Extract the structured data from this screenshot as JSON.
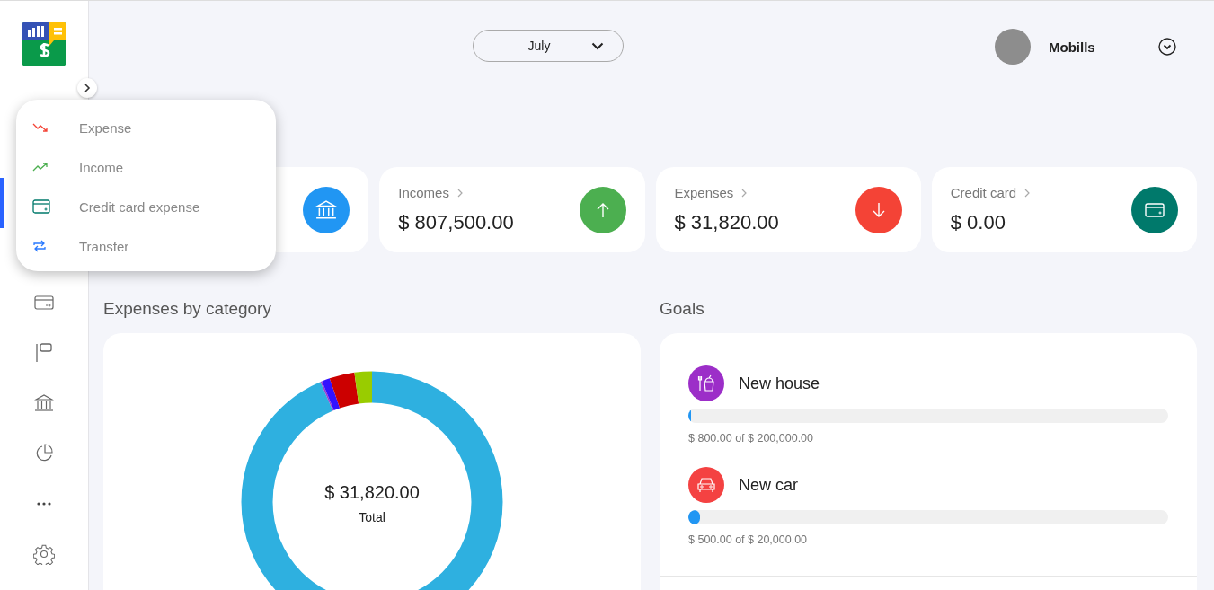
{
  "sidebar": {
    "items": [
      {
        "kind": "card"
      },
      {
        "kind": "flag"
      },
      {
        "kind": "bank"
      },
      {
        "kind": "pie"
      },
      {
        "kind": "more"
      },
      {
        "kind": "settings"
      }
    ]
  },
  "new_menu": {
    "items": [
      {
        "kind": "expense",
        "label": "Expense"
      },
      {
        "kind": "income",
        "label": "Income"
      },
      {
        "kind": "credit_card",
        "label": "Credit card expense"
      },
      {
        "kind": "transfer",
        "label": "Transfer"
      }
    ]
  },
  "month_selector": {
    "value": "July"
  },
  "user": {
    "name": "Mobills"
  },
  "summary_cards": [
    {
      "kind": "balance"
    },
    {
      "kind": "income",
      "label": "Incomes",
      "amount": "$ 807,500.00"
    },
    {
      "kind": "expense",
      "label": "Expenses",
      "amount": "$ 31,820.00"
    },
    {
      "kind": "credit_card",
      "label": "Credit card",
      "amount": "$ 0.00"
    }
  ],
  "expenses_by_category": {
    "title": "Expenses by category",
    "total": "$ 31,820.00",
    "total_label": "Total"
  },
  "goals": {
    "title": "Goals",
    "items": [
      {
        "kind": "food",
        "name": "New house",
        "level": 0.004,
        "progress": "$ 800.00 of $ 200,000.00"
      },
      {
        "kind": "car",
        "name": "New car",
        "level": 0.025,
        "progress": "$ 500.00 of $ 20,000.00"
      }
    ]
  }
}
